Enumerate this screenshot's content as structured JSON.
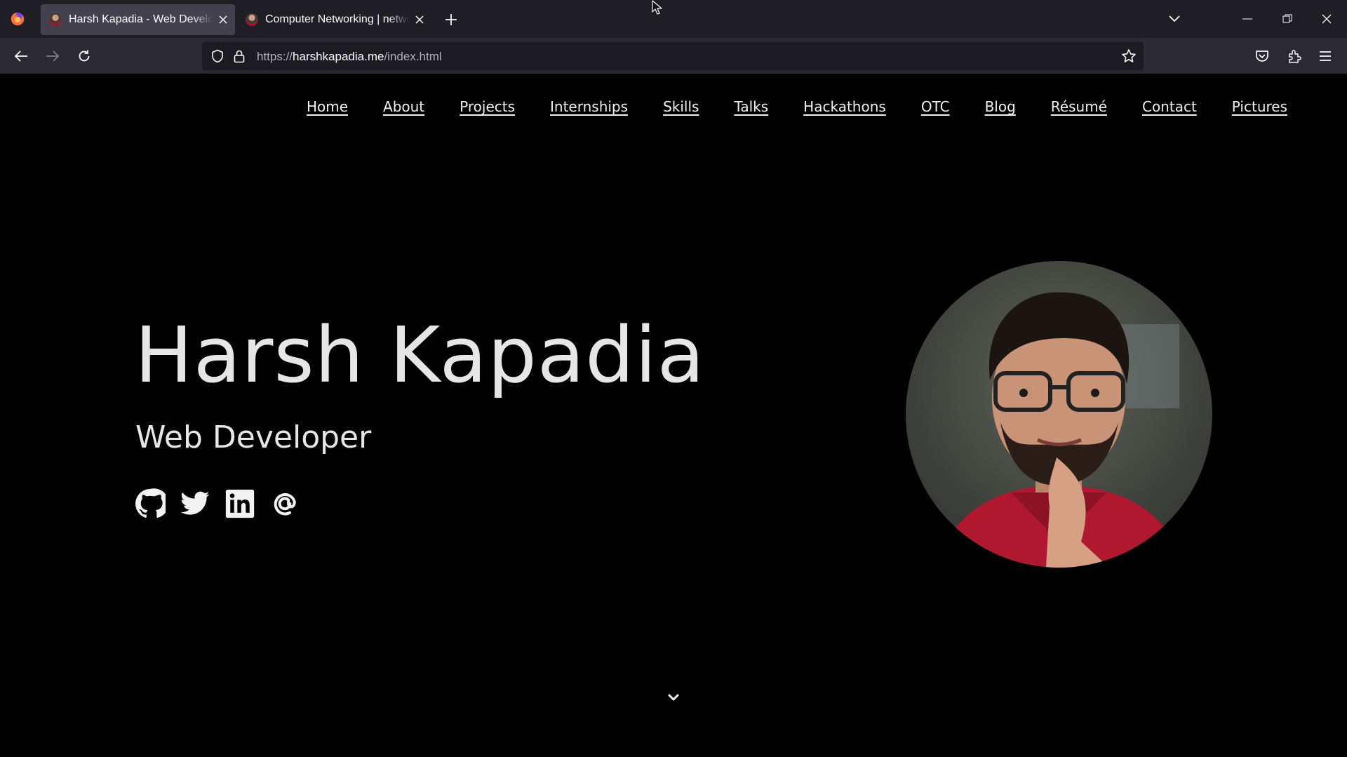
{
  "browser": {
    "tabs": [
      {
        "title": "Harsh Kapadia - Web Developer",
        "active": true
      },
      {
        "title": "Computer Networking | networking",
        "active": false
      }
    ],
    "url": {
      "scheme": "https://",
      "host": "harshkapadia.me",
      "path": "/index.html"
    }
  },
  "site": {
    "nav": [
      "Home",
      "About",
      "Projects",
      "Internships",
      "Skills",
      "Talks",
      "Hackathons",
      "OTC",
      "Blog",
      "Résumé",
      "Contact",
      "Pictures"
    ],
    "hero": {
      "name": "Harsh Kapadia",
      "role": "Web Developer"
    },
    "socials": [
      "github-icon",
      "twitter-icon",
      "linkedin-icon",
      "email-at-icon"
    ]
  },
  "colors": {
    "page_bg": "#000000",
    "tab_strip": "#1f1e25",
    "toolbar": "#2b2a33",
    "urlbar": "#1c1b22",
    "text": "#e6e6e6"
  }
}
